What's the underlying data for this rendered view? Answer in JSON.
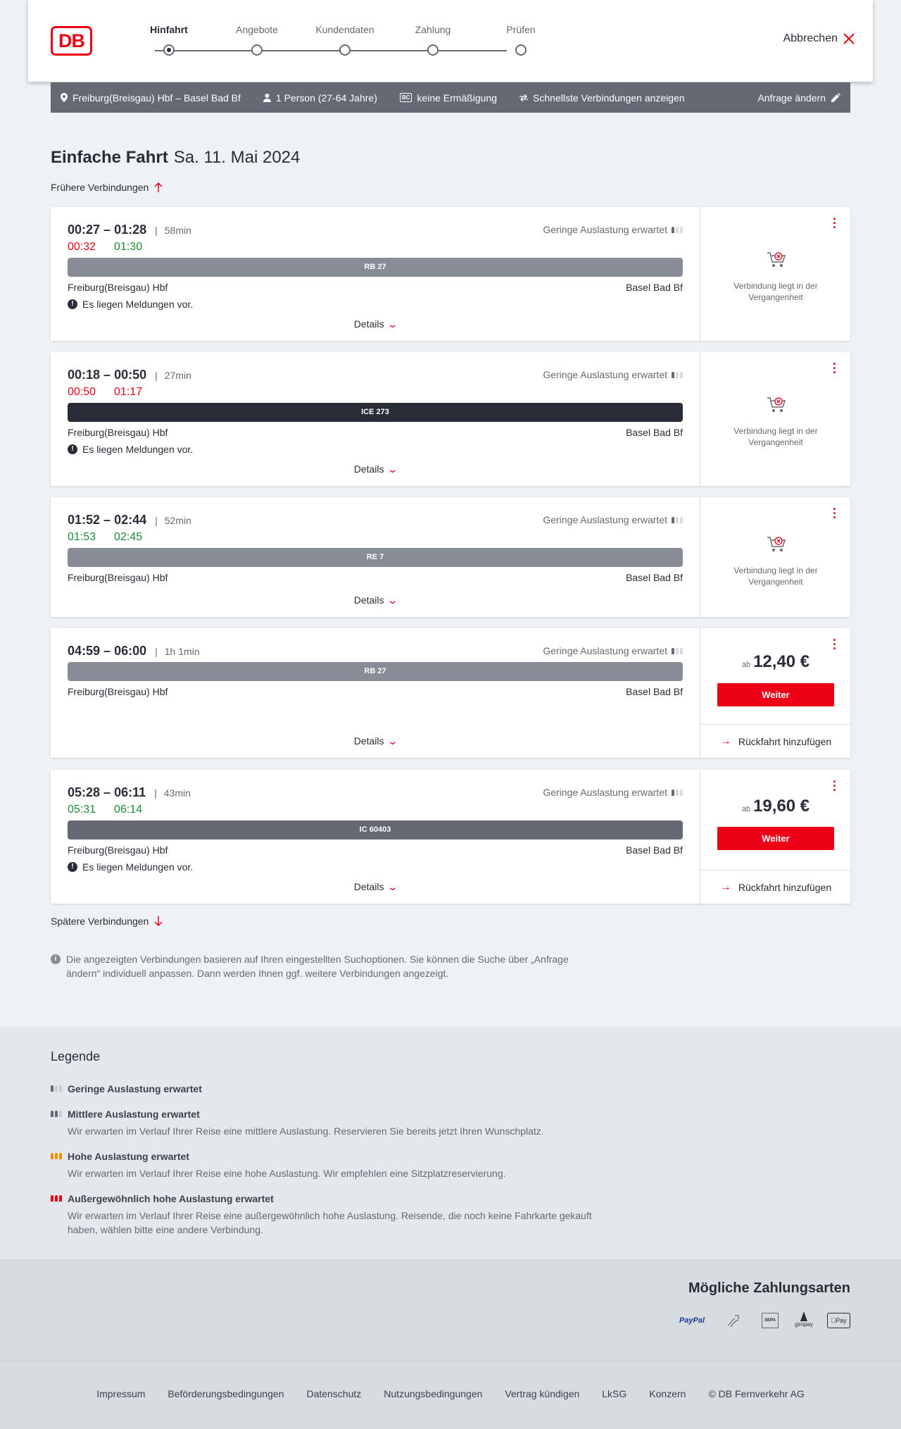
{
  "header": {
    "logo_text": "DB",
    "steps": [
      "Hinfahrt",
      "Angebote",
      "Kundendaten",
      "Zahlung",
      "Prüfen"
    ],
    "active_step": "Hinfahrt",
    "cancel_label": "Abbrechen"
  },
  "infobar": {
    "route": "Freiburg(Breisgau) Hbf – Basel Bad Bf",
    "travellers": "1 Person (27-64 Jahre)",
    "bahncard_icon": "BC",
    "discount": "keine Ermäßigung",
    "option": "Schnellste Verbindungen anzeigen",
    "change": "Anfrage ändern"
  },
  "title": {
    "type": "Einfache Fahrt",
    "date": "Sa. 11. Mai 2024"
  },
  "earlier": "Frühere Verbindungen",
  "later": "Spätere Verbindungen",
  "common": {
    "load": "Geringe Auslastung erwartet",
    "details": "Details",
    "message": "Es liegen Meldungen vor.",
    "past_line1": "Verbindung liegt in der",
    "past_line2": "Vergangenheit",
    "ab": "ab",
    "weiter": "Weiter",
    "return": "Rückfahrt hinzufügen",
    "from": "Freiburg(Breisgau) Hbf",
    "to": "Basel Bad Bf"
  },
  "connections": [
    {
      "dep": "00:27",
      "arr": "01:28",
      "duration": "58min",
      "rt_dep": "00:32",
      "rt_arr": "01:30",
      "train": "RB 27"
    },
    {
      "dep": "00:18",
      "arr": "00:50",
      "duration": "27min",
      "rt_dep": "00:50",
      "rt_arr": "01:17",
      "train": "ICE 273"
    },
    {
      "dep": "01:52",
      "arr": "02:44",
      "duration": "52min",
      "rt_dep": "01:53",
      "rt_arr": "02:45",
      "train": "RE 7"
    },
    {
      "dep": "04:59",
      "arr": "06:00",
      "duration": "1h 1min",
      "train": "RB 27",
      "price": "12,40 €"
    },
    {
      "dep": "05:28",
      "arr": "06:11",
      "duration": "43min",
      "rt_dep": "05:31",
      "rt_arr": "06:14",
      "train": "IC 60403",
      "price": "19,60 €"
    }
  ],
  "note": "Die angezeigten Verbindungen basieren auf Ihren eingestellten Suchoptionen. Sie können die Suche über „Anfrage ändern“ individuell anpassen. Dann werden Ihnen ggf. weitere Verbindungen angezeigt.",
  "legend": {
    "title": "Legende",
    "items": [
      {
        "title": "Geringe Auslastung erwartet",
        "desc": ""
      },
      {
        "title": "Mittlere Auslastung erwartet",
        "desc": "Wir erwarten im Verlauf Ihrer Reise eine mittlere Auslastung. Reservieren Sie bereits jetzt Ihren Wunschplatz."
      },
      {
        "title": "Hohe Auslastung erwartet",
        "desc": "Wir erwarten im Verlauf Ihrer Reise eine hohe Auslastung. Wir empfehlen eine Sitzplatzreservierung."
      },
      {
        "title": "Außergewöhnlich hohe Auslastung erwartet",
        "desc": "Wir erwarten im Verlauf Ihrer Reise eine außergewöhnlich hohe Auslastung. Reisende, die noch keine Fahrkarte gekauft haben, wählen bitte eine andere Verbindung."
      }
    ]
  },
  "payments": {
    "title": "Mögliche Zahlungsarten",
    "methods": [
      "PayPal",
      "SEPA",
      "giropay",
      "Pay"
    ]
  },
  "footer": {
    "links": [
      "Impressum",
      "Beförderungsbedingungen",
      "Datenschutz",
      "Nutzungsbedingungen",
      "Vertrag kündigen",
      "LkSG",
      "Konzern"
    ],
    "copyright": "© DB Fernverkehr AG"
  },
  "colors": {
    "accent": "#ec0016",
    "delay": "#ec0016",
    "ontime": "#1e8a36",
    "infobar": "#646973"
  }
}
